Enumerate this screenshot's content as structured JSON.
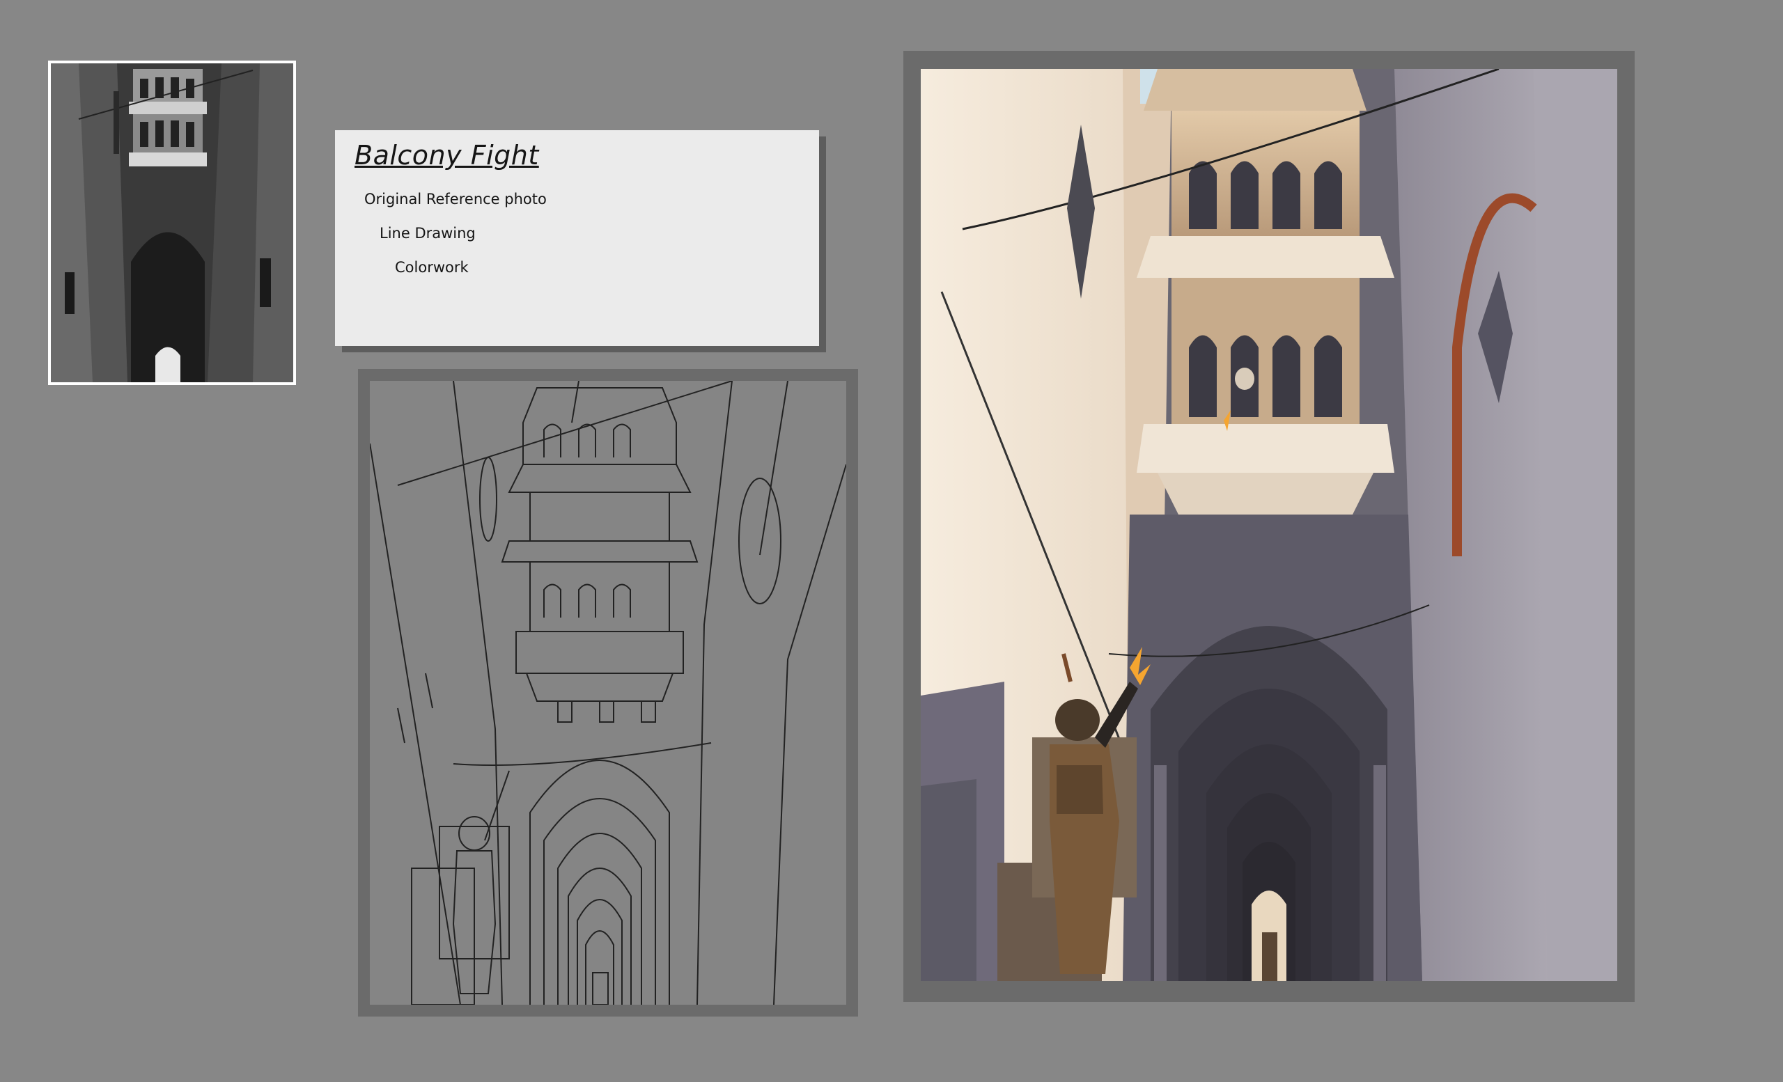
{
  "card": {
    "title": "Balcony Fight",
    "items": [
      "Original Reference photo",
      "Line Drawing",
      "Colorwork"
    ]
  },
  "colors": {
    "background": "#878787",
    "card_bg": "#ebebeb",
    "frame": "#6b6b6b",
    "sky_glow": "#fbf3e7",
    "stone_warm": "#c6a888",
    "shadow_violet": "#5c5a66",
    "muzzle_flash": "#f5a530",
    "soldier": "#7a5a3a"
  },
  "images": {
    "reference": "reference-photo-alley-balcony",
    "line_drawing": "line-drawing-alley-soldier",
    "colorwork": "colorwork-alley-soldier"
  }
}
